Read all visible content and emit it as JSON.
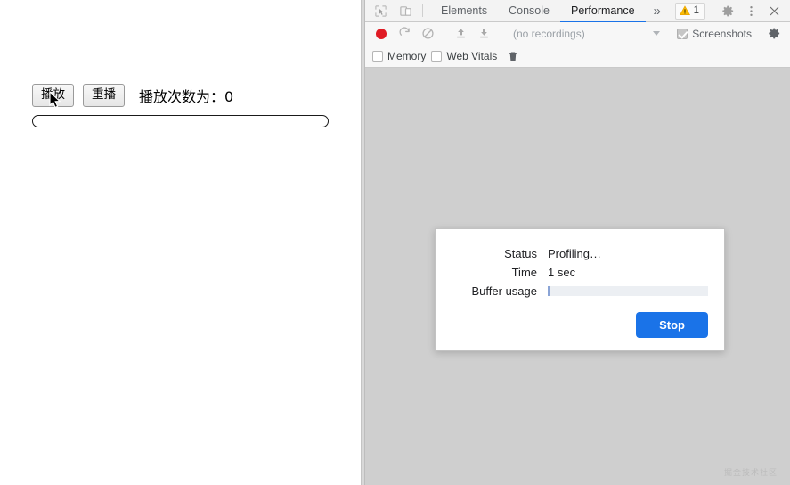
{
  "page": {
    "play_button": "播放",
    "replay_button": "重播",
    "count_text": "播放次数为：0",
    "progress_value": 0
  },
  "devtools": {
    "tabbar": {
      "inspect_icon": "inspect-element-icon",
      "device_icon": "device-toolbar-icon",
      "tabs": [
        {
          "label": "Elements",
          "active": false
        },
        {
          "label": "Console",
          "active": false
        },
        {
          "label": "Performance",
          "active": true
        }
      ],
      "more_tabs": "»",
      "warning_count": "1",
      "warning_icon": "warning-triangle-icon",
      "settings_icon": "gear-icon",
      "menu_icon": "kebab-menu-icon",
      "close_icon": "close-icon",
      "accent_color": "#1a73e8"
    },
    "toolbar": {
      "record_icon": "record-circle-icon",
      "reload_icon": "reload-and-record-icon",
      "clear_icon": "clear-recording-icon",
      "load_icon": "load-profile-icon",
      "save_icon": "save-profile-icon",
      "recordings_value": "(no recordings)",
      "recordings_caret": "chevron-down-icon",
      "screenshots_label": "Screenshots",
      "screenshots_checked": true,
      "capture_settings_icon": "gear-icon"
    },
    "toolbar2": {
      "memory_label": "Memory",
      "memory_checked": false,
      "web_vitals_label": "Web Vitals",
      "web_vitals_checked": false,
      "trash_icon": "trash-icon"
    },
    "dialog": {
      "rows": [
        {
          "label": "Status",
          "value": "Profiling…",
          "type": "text"
        },
        {
          "label": "Time",
          "value": "1 sec",
          "type": "text"
        },
        {
          "label": "Buffer usage",
          "value": "",
          "type": "bar",
          "percent": 1
        }
      ],
      "status_label": "Status",
      "status_value": "Profiling…",
      "time_label": "Time",
      "time_value": "1 sec",
      "buffer_label": "Buffer usage",
      "buffer_percent": 1,
      "stop_label": "Stop",
      "stop_color": "#1a73e8"
    },
    "watermark": "掘金技术社区"
  }
}
